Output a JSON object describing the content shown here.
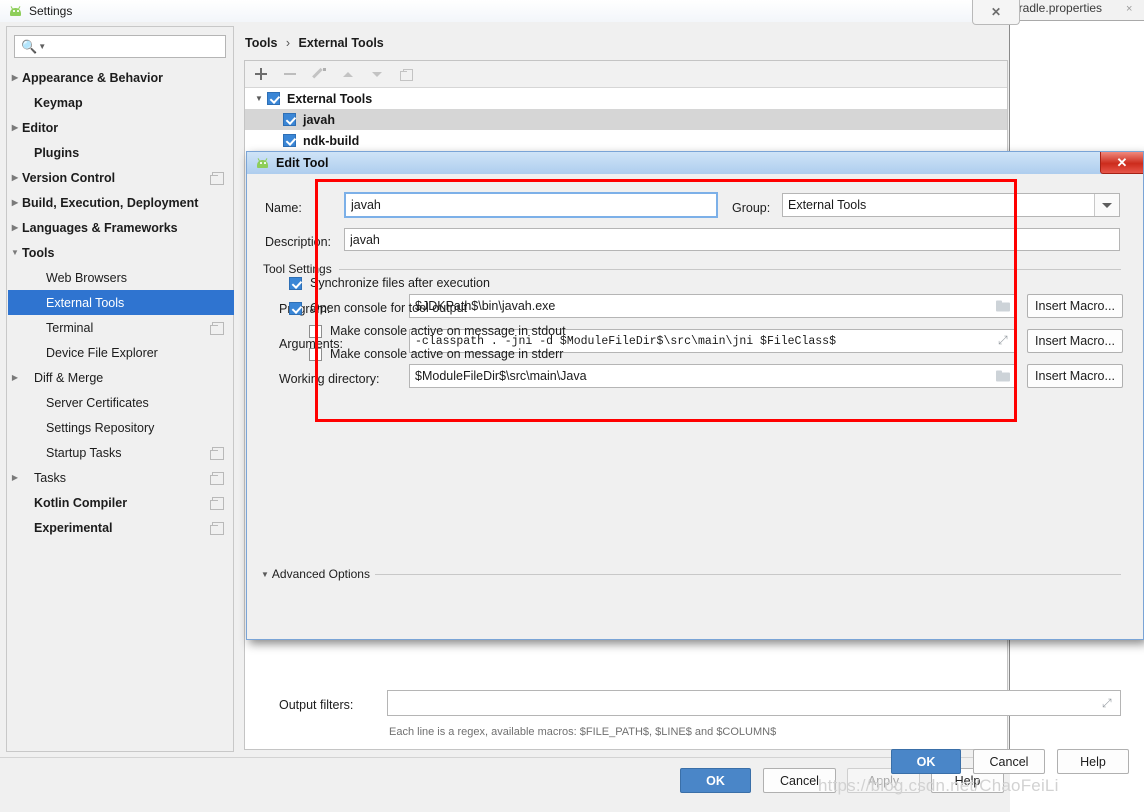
{
  "window": {
    "title": "Settings",
    "app_icon": "android-icon",
    "close_label": "✕"
  },
  "background_editor": {
    "tab_label": "gradle.properties",
    "tab_close": "×"
  },
  "search": {
    "value": "",
    "placeholder": "",
    "icon": "search-icon"
  },
  "sidebar": {
    "items": [
      {
        "label": "Appearance & Behavior",
        "twisty": "▶",
        "bold": true,
        "indent": 0,
        "selected": false,
        "badge": false
      },
      {
        "label": "Keymap",
        "twisty": "",
        "bold": true,
        "indent": 1,
        "selected": false,
        "badge": false
      },
      {
        "label": "Editor",
        "twisty": "▶",
        "bold": true,
        "indent": 0,
        "selected": false,
        "badge": false
      },
      {
        "label": "Plugins",
        "twisty": "",
        "bold": true,
        "indent": 1,
        "selected": false,
        "badge": false
      },
      {
        "label": "Version Control",
        "twisty": "▶",
        "bold": true,
        "indent": 0,
        "selected": false,
        "badge": true
      },
      {
        "label": "Build, Execution, Deployment",
        "twisty": "▶",
        "bold": true,
        "indent": 0,
        "selected": false,
        "badge": false
      },
      {
        "label": "Languages & Frameworks",
        "twisty": "▶",
        "bold": true,
        "indent": 0,
        "selected": false,
        "badge": false
      },
      {
        "label": "Tools",
        "twisty": "▼",
        "bold": true,
        "indent": 0,
        "selected": false,
        "badge": false
      },
      {
        "label": "Web Browsers",
        "twisty": "",
        "bold": false,
        "indent": 2,
        "selected": false,
        "badge": false
      },
      {
        "label": "External Tools",
        "twisty": "",
        "bold": false,
        "indent": 2,
        "selected": true,
        "badge": false
      },
      {
        "label": "Terminal",
        "twisty": "",
        "bold": false,
        "indent": 2,
        "selected": false,
        "badge": true
      },
      {
        "label": "Device File Explorer",
        "twisty": "",
        "bold": false,
        "indent": 2,
        "selected": false,
        "badge": false
      },
      {
        "label": "Diff & Merge",
        "twisty": "▶",
        "bold": false,
        "indent": 1,
        "selected": false,
        "badge": false
      },
      {
        "label": "Server Certificates",
        "twisty": "",
        "bold": false,
        "indent": 2,
        "selected": false,
        "badge": false
      },
      {
        "label": "Settings Repository",
        "twisty": "",
        "bold": false,
        "indent": 2,
        "selected": false,
        "badge": false
      },
      {
        "label": "Startup Tasks",
        "twisty": "",
        "bold": false,
        "indent": 2,
        "selected": false,
        "badge": true
      },
      {
        "label": "Tasks",
        "twisty": "▶",
        "bold": false,
        "indent": 1,
        "selected": false,
        "badge": true
      },
      {
        "label": "Kotlin Compiler",
        "twisty": "",
        "bold": true,
        "indent": 1,
        "selected": false,
        "badge": true
      },
      {
        "label": "Experimental",
        "twisty": "",
        "bold": true,
        "indent": 1,
        "selected": false,
        "badge": true
      }
    ]
  },
  "content": {
    "breadcrumb": {
      "parent": "Tools",
      "separator": "›",
      "current": "External Tools"
    },
    "toolbar": [
      {
        "name": "add-icon",
        "glyph": "+"
      },
      {
        "name": "remove-icon",
        "glyph": "−"
      },
      {
        "name": "edit-pencil-icon",
        "glyph": "✎"
      },
      {
        "name": "move-up-icon",
        "glyph": "▲"
      },
      {
        "name": "move-down-icon",
        "glyph": "▼"
      },
      {
        "name": "copy-icon",
        "glyph": "⧉"
      }
    ],
    "tools_tree": [
      {
        "label": "External Tools",
        "twisty": "▼",
        "checked": true,
        "indent": 0,
        "highlight": false
      },
      {
        "label": "javah",
        "twisty": "",
        "checked": true,
        "indent": 1,
        "highlight": true
      },
      {
        "label": "ndk-build",
        "twisty": "",
        "checked": true,
        "indent": 1,
        "highlight": false
      }
    ]
  },
  "footer": {
    "ok": "OK",
    "cancel": "Cancel",
    "apply": "Apply",
    "help": "Help"
  },
  "dialog": {
    "title": "Edit Tool",
    "icon": "android-icon",
    "close": "✕",
    "name_label": "Name:",
    "name_value": "javah",
    "group_label": "Group:",
    "group_value": "External Tools",
    "description_label": "Description:",
    "description_value": "javah",
    "tool_settings_legend": "Tool Settings",
    "program_label": "Program:",
    "program_value": "$JDKPath$\\bin\\javah.exe",
    "arguments_label": "Arguments:",
    "arguments_value": "-classpath . -jni -d $ModuleFileDir$\\src\\main\\jni $FileClass$",
    "working_dir_label": "Working directory:",
    "working_dir_value": "$ModuleFileDir$\\src\\main\\Java",
    "insert_macro_label": "Insert Macro...",
    "advanced_options_legend": "Advanced Options",
    "advanced_twisty": "▼",
    "checkboxes": [
      {
        "label": "Synchronize files after execution",
        "checked": true,
        "indent": 0
      },
      {
        "label": "Open console for tool output",
        "checked": true,
        "indent": 0
      },
      {
        "label": "Make console active on message in stdout",
        "checked": false,
        "indent": 1
      },
      {
        "label": "Make console active on message in stderr",
        "checked": false,
        "indent": 1
      }
    ],
    "output_filters_label": "Output filters:",
    "output_filters_value": "",
    "output_filters_hint": "Each line is a regex, available macros: $FILE_PATH$, $LINE$ and $COLUMN$",
    "ok": "OK",
    "cancel": "Cancel",
    "help": "Help"
  },
  "watermark": {
    "text_top": "https://blog.csdn.net/ChaoFeiLi",
    "text_bottom": "https://blog.csdn.net/ChaoFeiLi"
  },
  "colors": {
    "accent_blue": "#2f74d0",
    "primary_button": "#4a86c8",
    "highlight_red": "#ff0000",
    "checkbox_blue": "#3a86d6",
    "dialog_titlebar": "#aecdee"
  }
}
